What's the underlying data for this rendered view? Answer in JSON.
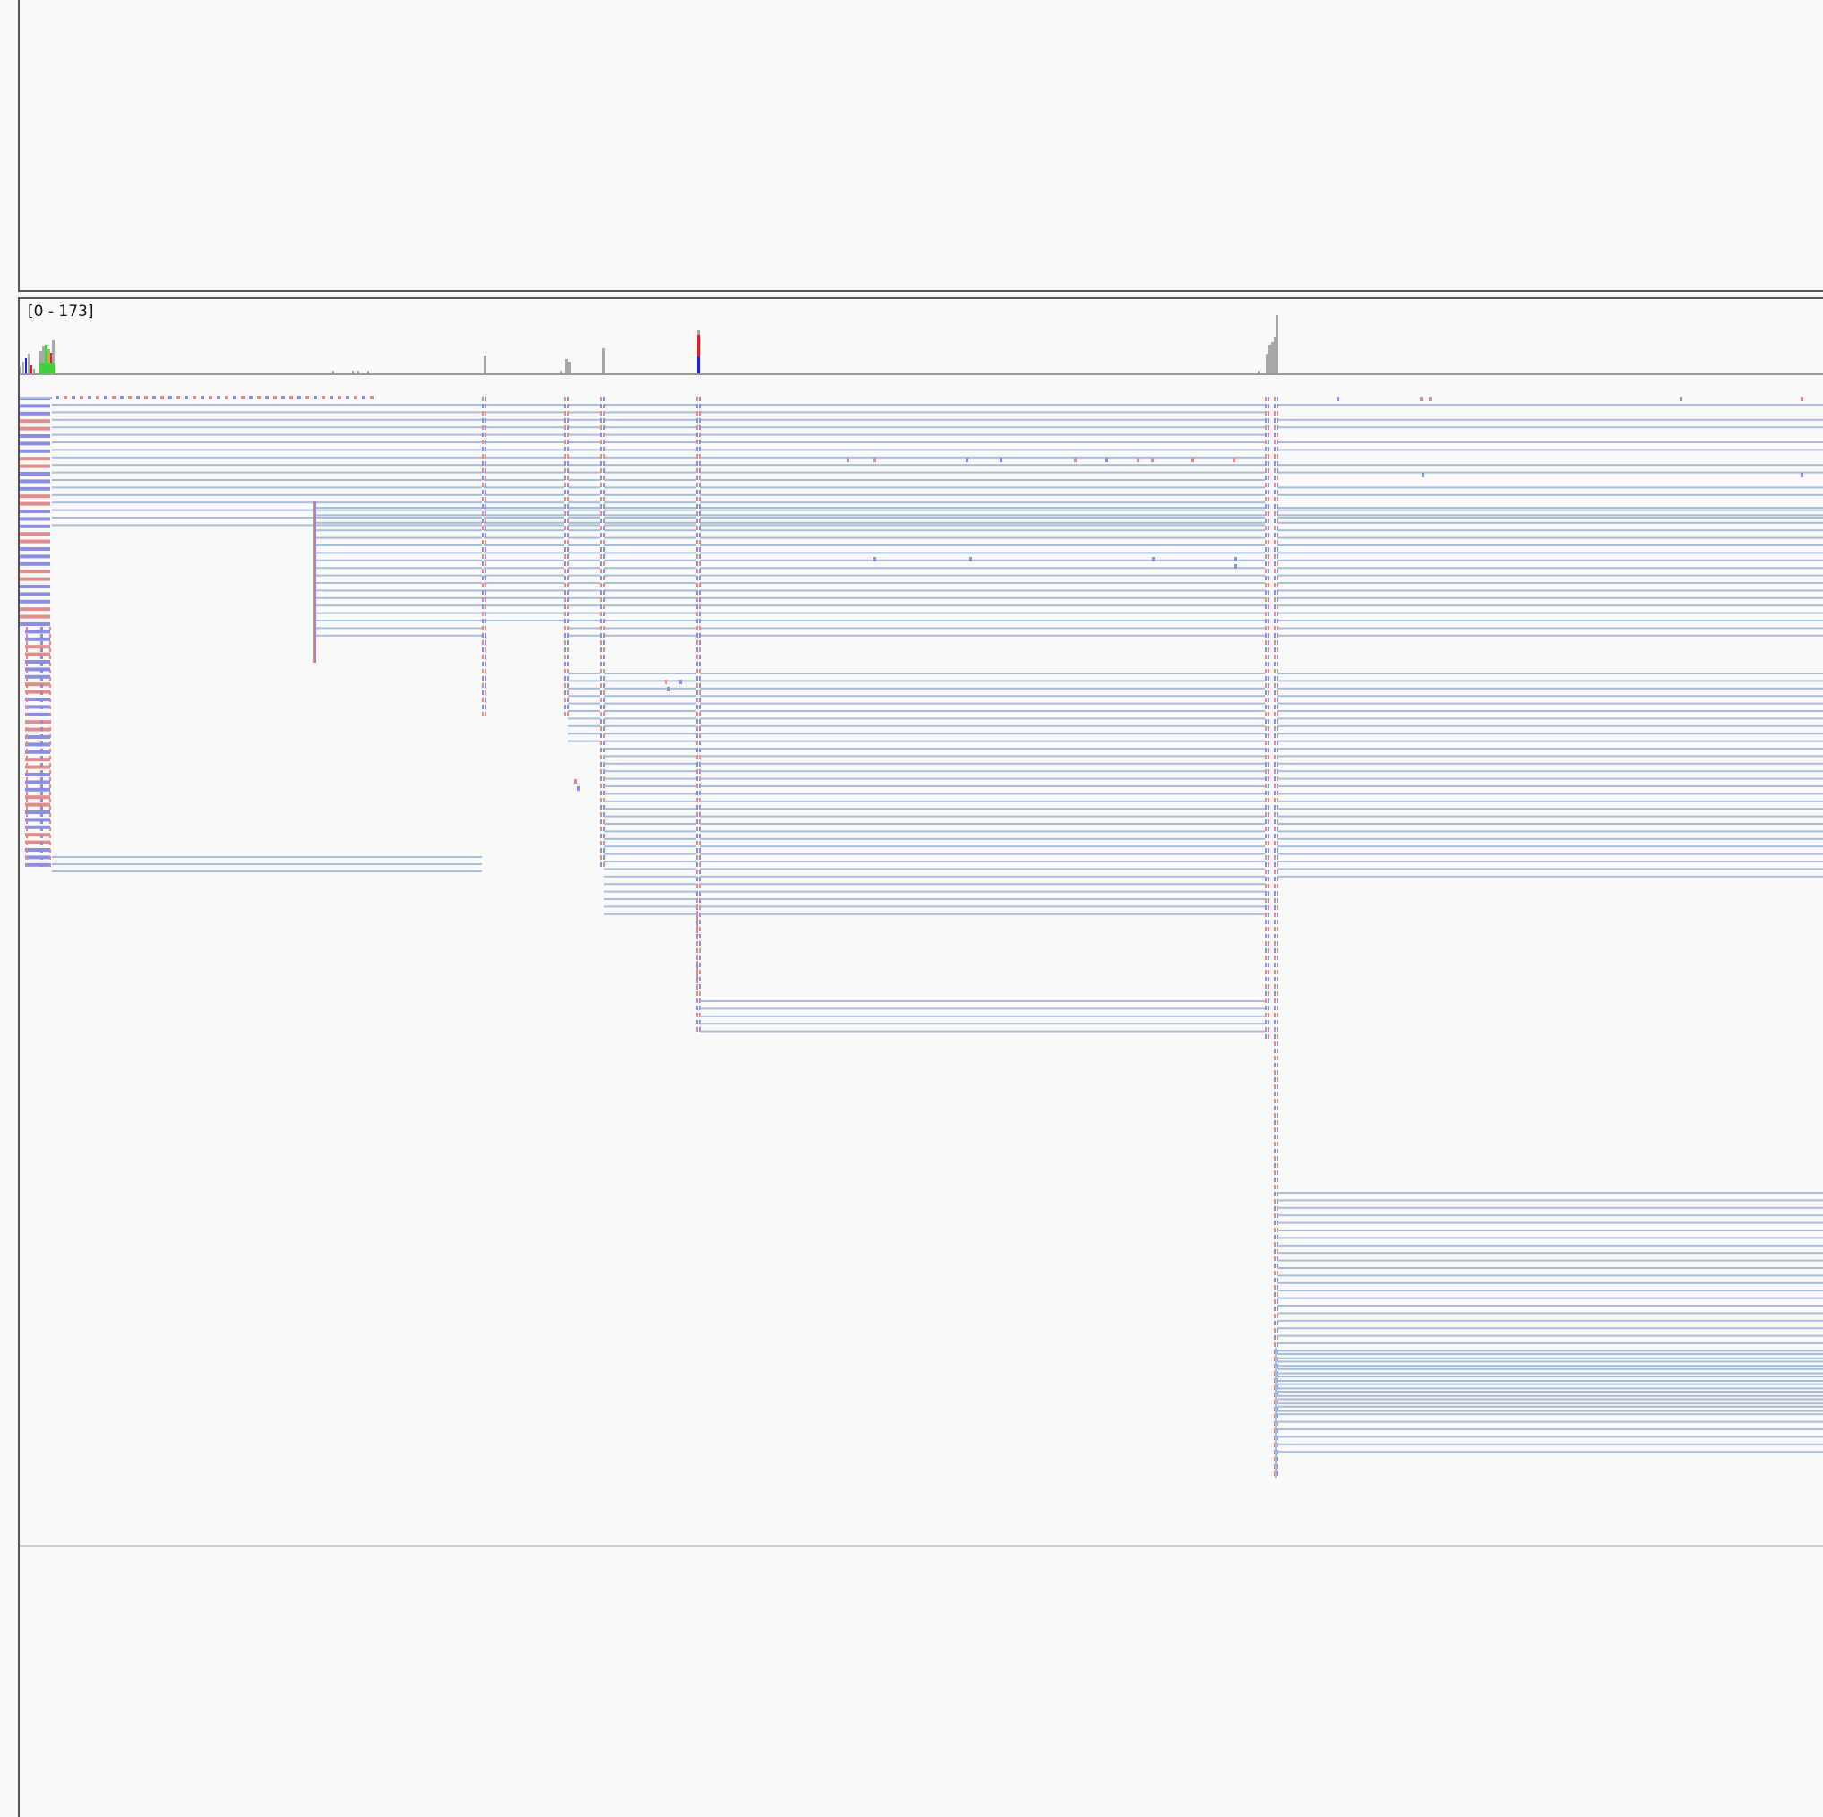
{
  "coverage_track": {
    "range_label": "[0 - 173]"
  },
  "colors": {
    "background": "#f9f9f9",
    "border": "#555555",
    "coverage": "#a8a8a8",
    "intron_line": "#a6bdd7",
    "read_forward": "#e08c8c",
    "read_reverse": "#8c8ce0",
    "mismatch_red": "#e02020",
    "mismatch_blue": "#2020e0",
    "mismatch_green": "#40d040",
    "separator": "#cccccc"
  }
}
